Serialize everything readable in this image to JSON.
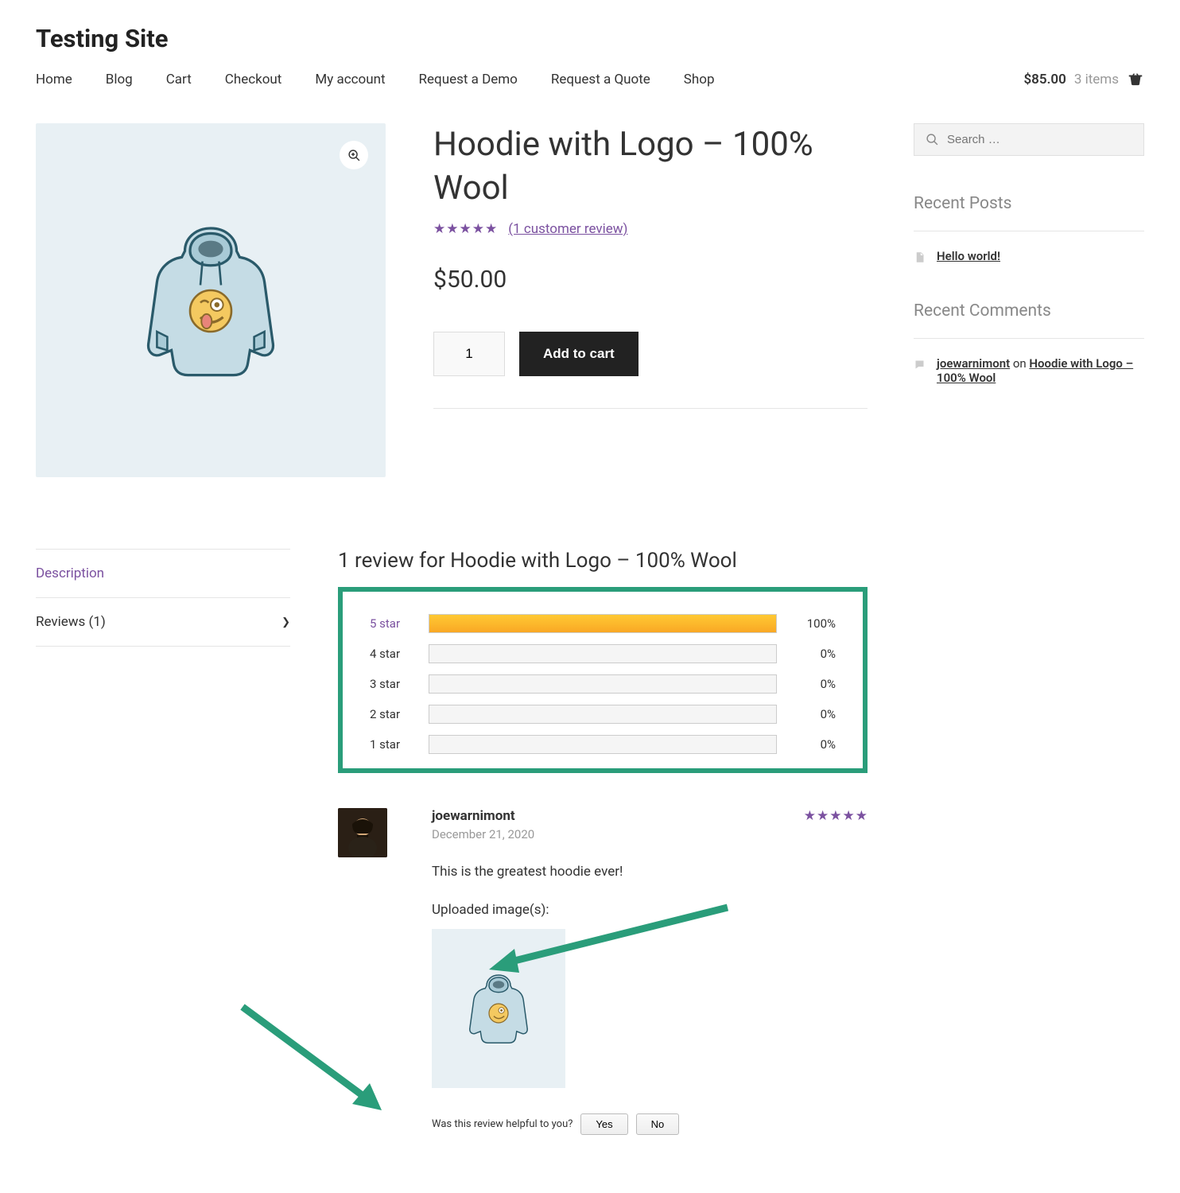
{
  "site_title": "Testing Site",
  "nav": [
    "Home",
    "Blog",
    "Cart",
    "Checkout",
    "My account",
    "Request a Demo",
    "Request a Quote",
    "Shop"
  ],
  "cart": {
    "price": "$85.00",
    "items": "3 items"
  },
  "product": {
    "title": "Hoodie with Logo – 100% Wool",
    "review_link": "(1 customer review)",
    "price": "$50.00",
    "qty": "1",
    "add_label": "Add to cart"
  },
  "tabs": {
    "description": "Description",
    "reviews": "Reviews (1)"
  },
  "reviews_section": {
    "title": "1 review for Hoodie with Logo – 100% Wool",
    "breakdown": [
      {
        "label": "5 star",
        "pct": "100%",
        "fill": 100
      },
      {
        "label": "4 star",
        "pct": "0%",
        "fill": 0
      },
      {
        "label": "3 star",
        "pct": "0%",
        "fill": 0
      },
      {
        "label": "2 star",
        "pct": "0%",
        "fill": 0
      },
      {
        "label": "1 star",
        "pct": "0%",
        "fill": 0
      }
    ]
  },
  "review": {
    "author": "joewarnimont",
    "date": "December 21, 2020",
    "text": "This is the greatest hoodie ever!",
    "uploaded_label": "Uploaded image(s):",
    "helpful_q": "Was this review helpful to you?",
    "yes": "Yes",
    "no": "No"
  },
  "sidebar": {
    "search_placeholder": "Search …",
    "recent_posts": {
      "title": "Recent Posts",
      "item": "Hello world!"
    },
    "recent_comments": {
      "title": "Recent Comments",
      "author": "joewarnimont",
      "on": " on ",
      "post": "Hoodie with Logo – 100% Wool"
    }
  }
}
